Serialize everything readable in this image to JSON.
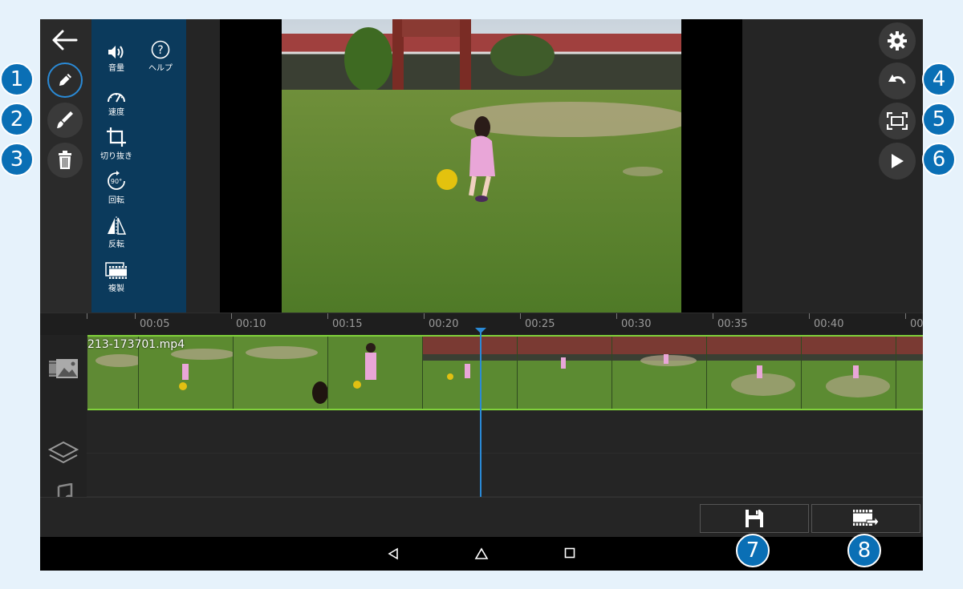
{
  "tools": {
    "volume": "音量",
    "help": "ヘルプ",
    "speed": "速度",
    "crop": "切り抜き",
    "rotate": "回転",
    "rotate_badge": "90°",
    "flip": "反転",
    "duplicate": "複製"
  },
  "timeline": {
    "ticks": [
      "00:05",
      "00:10",
      "00:15",
      "00:20",
      "00:25",
      "00:30",
      "00:35",
      "00:40",
      "00"
    ],
    "clip_name": "213-173701.mp4"
  },
  "callouts": [
    "1",
    "2",
    "3",
    "4",
    "5",
    "6",
    "7",
    "8"
  ],
  "colors": {
    "accent": "#2a8ad6",
    "panel": "#0b3a5c",
    "clip_border": "#7fd13b",
    "callout": "#0a6fb5"
  }
}
